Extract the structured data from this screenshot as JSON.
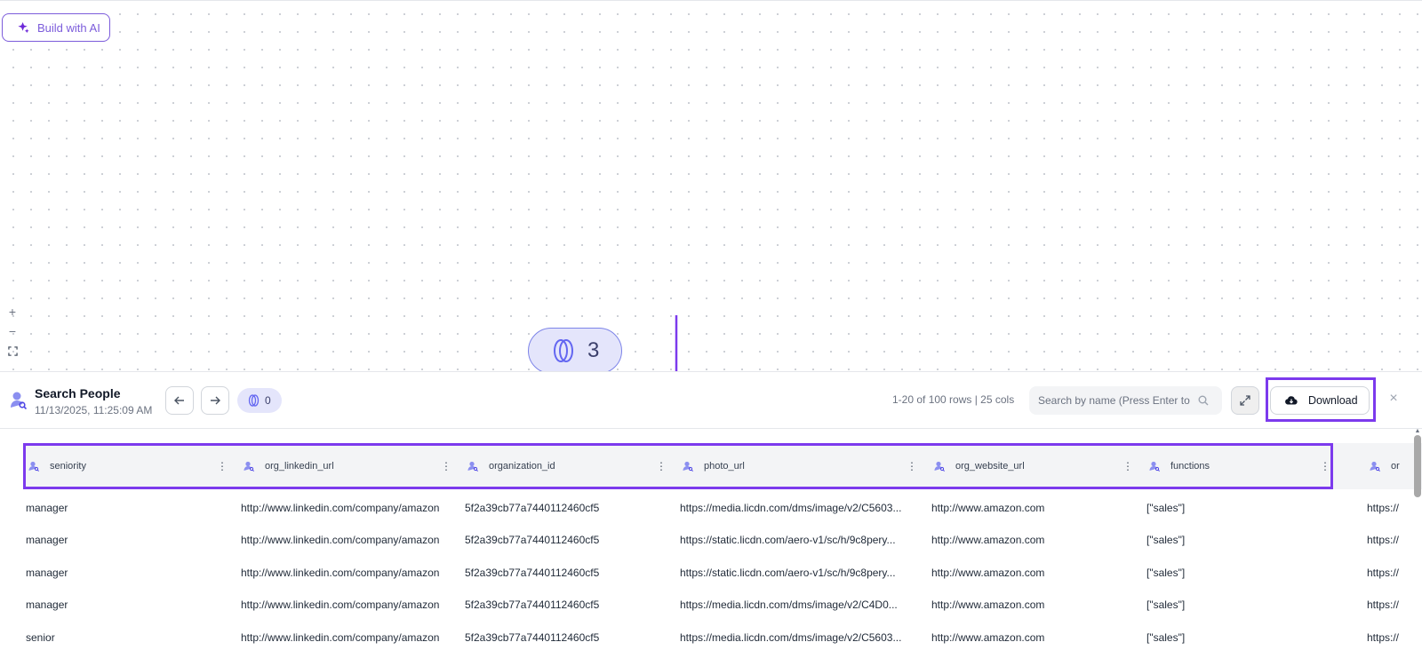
{
  "canvas": {
    "build_ai_label": "Build with AI",
    "credits_count": "3",
    "zoom": {
      "in": "+",
      "out": "−",
      "fit": "⛶"
    }
  },
  "panel": {
    "title": "Search People",
    "timestamp": "11/13/2025, 11:25:09 AM",
    "credits": "0",
    "rows_info": "1-20 of 100 rows | 25 cols",
    "search_placeholder": "Search by name (Press Enter to",
    "download_label": "Download",
    "close": "×"
  },
  "table": {
    "columns": [
      "seniority",
      "org_linkedin_url",
      "organization_id",
      "photo_url",
      "org_website_url",
      "functions",
      "or"
    ],
    "rows": [
      [
        "manager",
        "http://www.linkedin.com/company/amazon",
        "5f2a39cb77a7440112460cf5",
        "https://media.licdn.com/dms/image/v2/C5603...",
        "http://www.amazon.com",
        "[\"sales\"]",
        "https://"
      ],
      [
        "manager",
        "http://www.linkedin.com/company/amazon",
        "5f2a39cb77a7440112460cf5",
        "https://static.licdn.com/aero-v1/sc/h/9c8pery...",
        "http://www.amazon.com",
        "[\"sales\"]",
        "https://"
      ],
      [
        "manager",
        "http://www.linkedin.com/company/amazon",
        "5f2a39cb77a7440112460cf5",
        "https://static.licdn.com/aero-v1/sc/h/9c8pery...",
        "http://www.amazon.com",
        "[\"sales\"]",
        "https://"
      ],
      [
        "manager",
        "http://www.linkedin.com/company/amazon",
        "5f2a39cb77a7440112460cf5",
        "https://media.licdn.com/dms/image/v2/C4D0...",
        "http://www.amazon.com",
        "[\"sales\"]",
        "https://"
      ],
      [
        "senior",
        "http://www.linkedin.com/company/amazon",
        "5f2a39cb77a7440112460cf5",
        "https://media.licdn.com/dms/image/v2/C5603...",
        "http://www.amazon.com",
        "[\"sales\"]",
        "https://"
      ]
    ]
  },
  "colors": {
    "accent": "#7c3aed",
    "pill": "#e4e5fb",
    "icon": "#8b8ff0"
  },
  "icons": [
    "sparkle-icon",
    "person-search-icon",
    "coin-icon",
    "arrow-left-icon",
    "arrow-right-icon",
    "search-icon",
    "expand-icon",
    "cloud-download-icon",
    "close-icon",
    "kebab-menu-icon"
  ]
}
